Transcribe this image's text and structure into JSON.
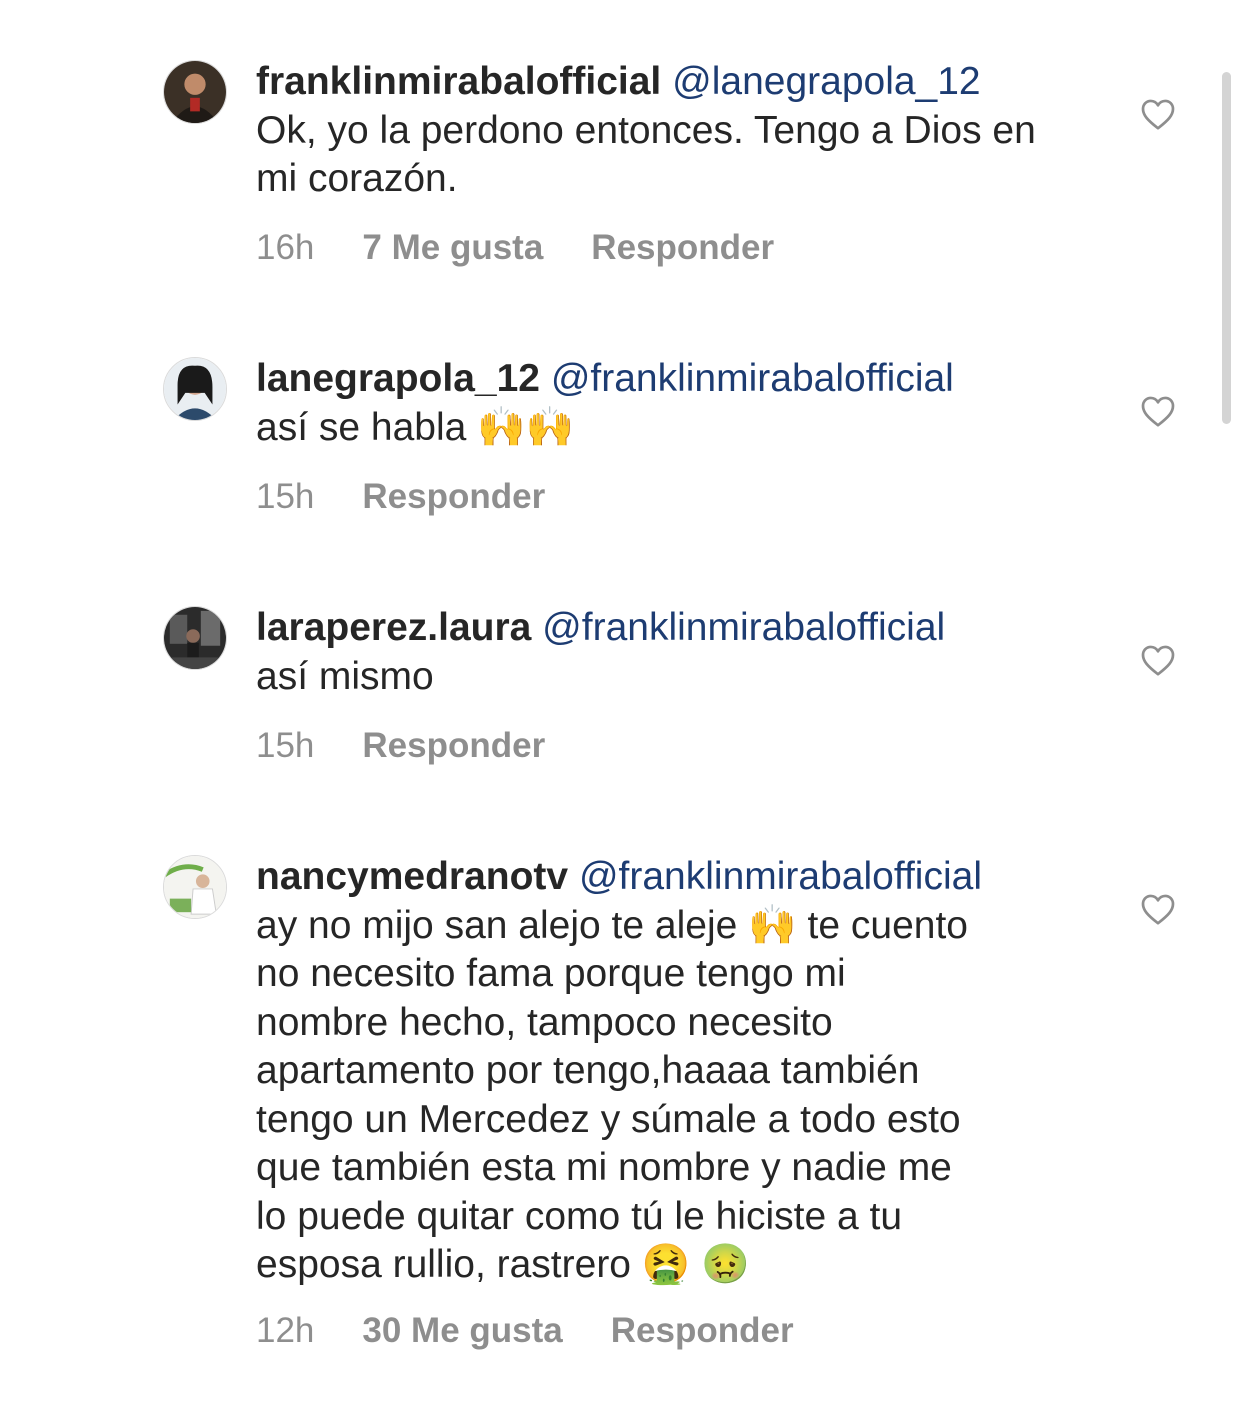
{
  "comments": [
    {
      "username": "franklinmirabalofficial",
      "mention": "@lanegrapola_12",
      "text": "Ok, yo la perdono entonces. Tengo a Dios en mi corazón.",
      "time": "16h",
      "likes": "7 Me gusta",
      "reply": "Responder"
    },
    {
      "username": "lanegrapola_12",
      "mention": "@franklinmirabalofficial",
      "text": "así se habla 🙌🙌",
      "time": "15h",
      "likes": "",
      "reply": "Responder"
    },
    {
      "username": "laraperez.laura",
      "mention": "@franklinmirabalofficial",
      "text": "así mismo",
      "time": "15h",
      "likes": "",
      "reply": "Responder"
    },
    {
      "username": "nancymedranotv",
      "mention": "@franklinmirabalofficial",
      "text_lines": [
        "ay no mijo san alejo te aleje 🙌 te cuento",
        "no necesito fama porque tengo mi",
        "nombre hecho, tampoco necesito",
        "apartamento por tengo,haaaa también",
        "tengo un Mercedez y súmale a todo esto",
        "que también esta mi nombre y nadie me",
        "lo puede quitar como tú le hiciste a tu",
        "esposa rullio, rastrero 🤮 🤢"
      ],
      "time": "12h",
      "likes": "30 Me gusta",
      "reply": "Responder"
    }
  ],
  "icons": {
    "like": "heart-outline-icon"
  },
  "colors": {
    "mention": "#1d3c72",
    "meta": "#8e8e8e",
    "text": "#262626"
  }
}
